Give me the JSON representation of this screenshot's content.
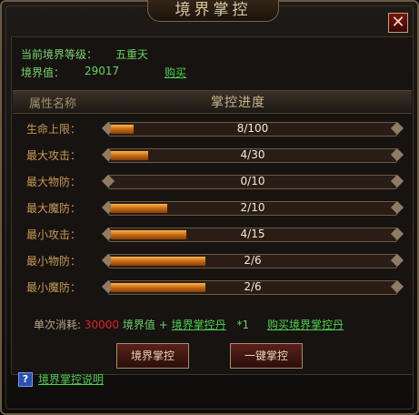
{
  "window": {
    "title": "境界掌控",
    "close_label": "✕"
  },
  "info": {
    "level_label": "当前境界等级：",
    "level_value": "五重天",
    "points_label": "境界值：",
    "points_value": "29017",
    "buy_label": "购买"
  },
  "header": {
    "name_col": "属性名称",
    "progress_col": "掌控进度"
  },
  "rows": [
    {
      "label": "生命上限：",
      "text": "8/100",
      "pct": 0.08
    },
    {
      "label": "最大攻击：",
      "text": "4/30",
      "pct": 0.133
    },
    {
      "label": "最大物防：",
      "text": "0/10",
      "pct": 0.0
    },
    {
      "label": "最大魔防：",
      "text": "2/10",
      "pct": 0.2
    },
    {
      "label": "最小攻击：",
      "text": "4/15",
      "pct": 0.267
    },
    {
      "label": "最小物防：",
      "text": "2/6",
      "pct": 0.333
    },
    {
      "label": "最小魔防：",
      "text": "2/6",
      "pct": 0.333
    }
  ],
  "cost": {
    "label": "单次消耗:",
    "amount": "30000",
    "unit": "境界值",
    "plus": "+",
    "item": "境界掌控丹",
    "qty": "*1",
    "buy_item": "购买境界掌控丹"
  },
  "buttons": {
    "control": "境界掌控",
    "one_key": "一键掌控"
  },
  "help": {
    "icon": "?",
    "text": "境界掌控说明"
  }
}
